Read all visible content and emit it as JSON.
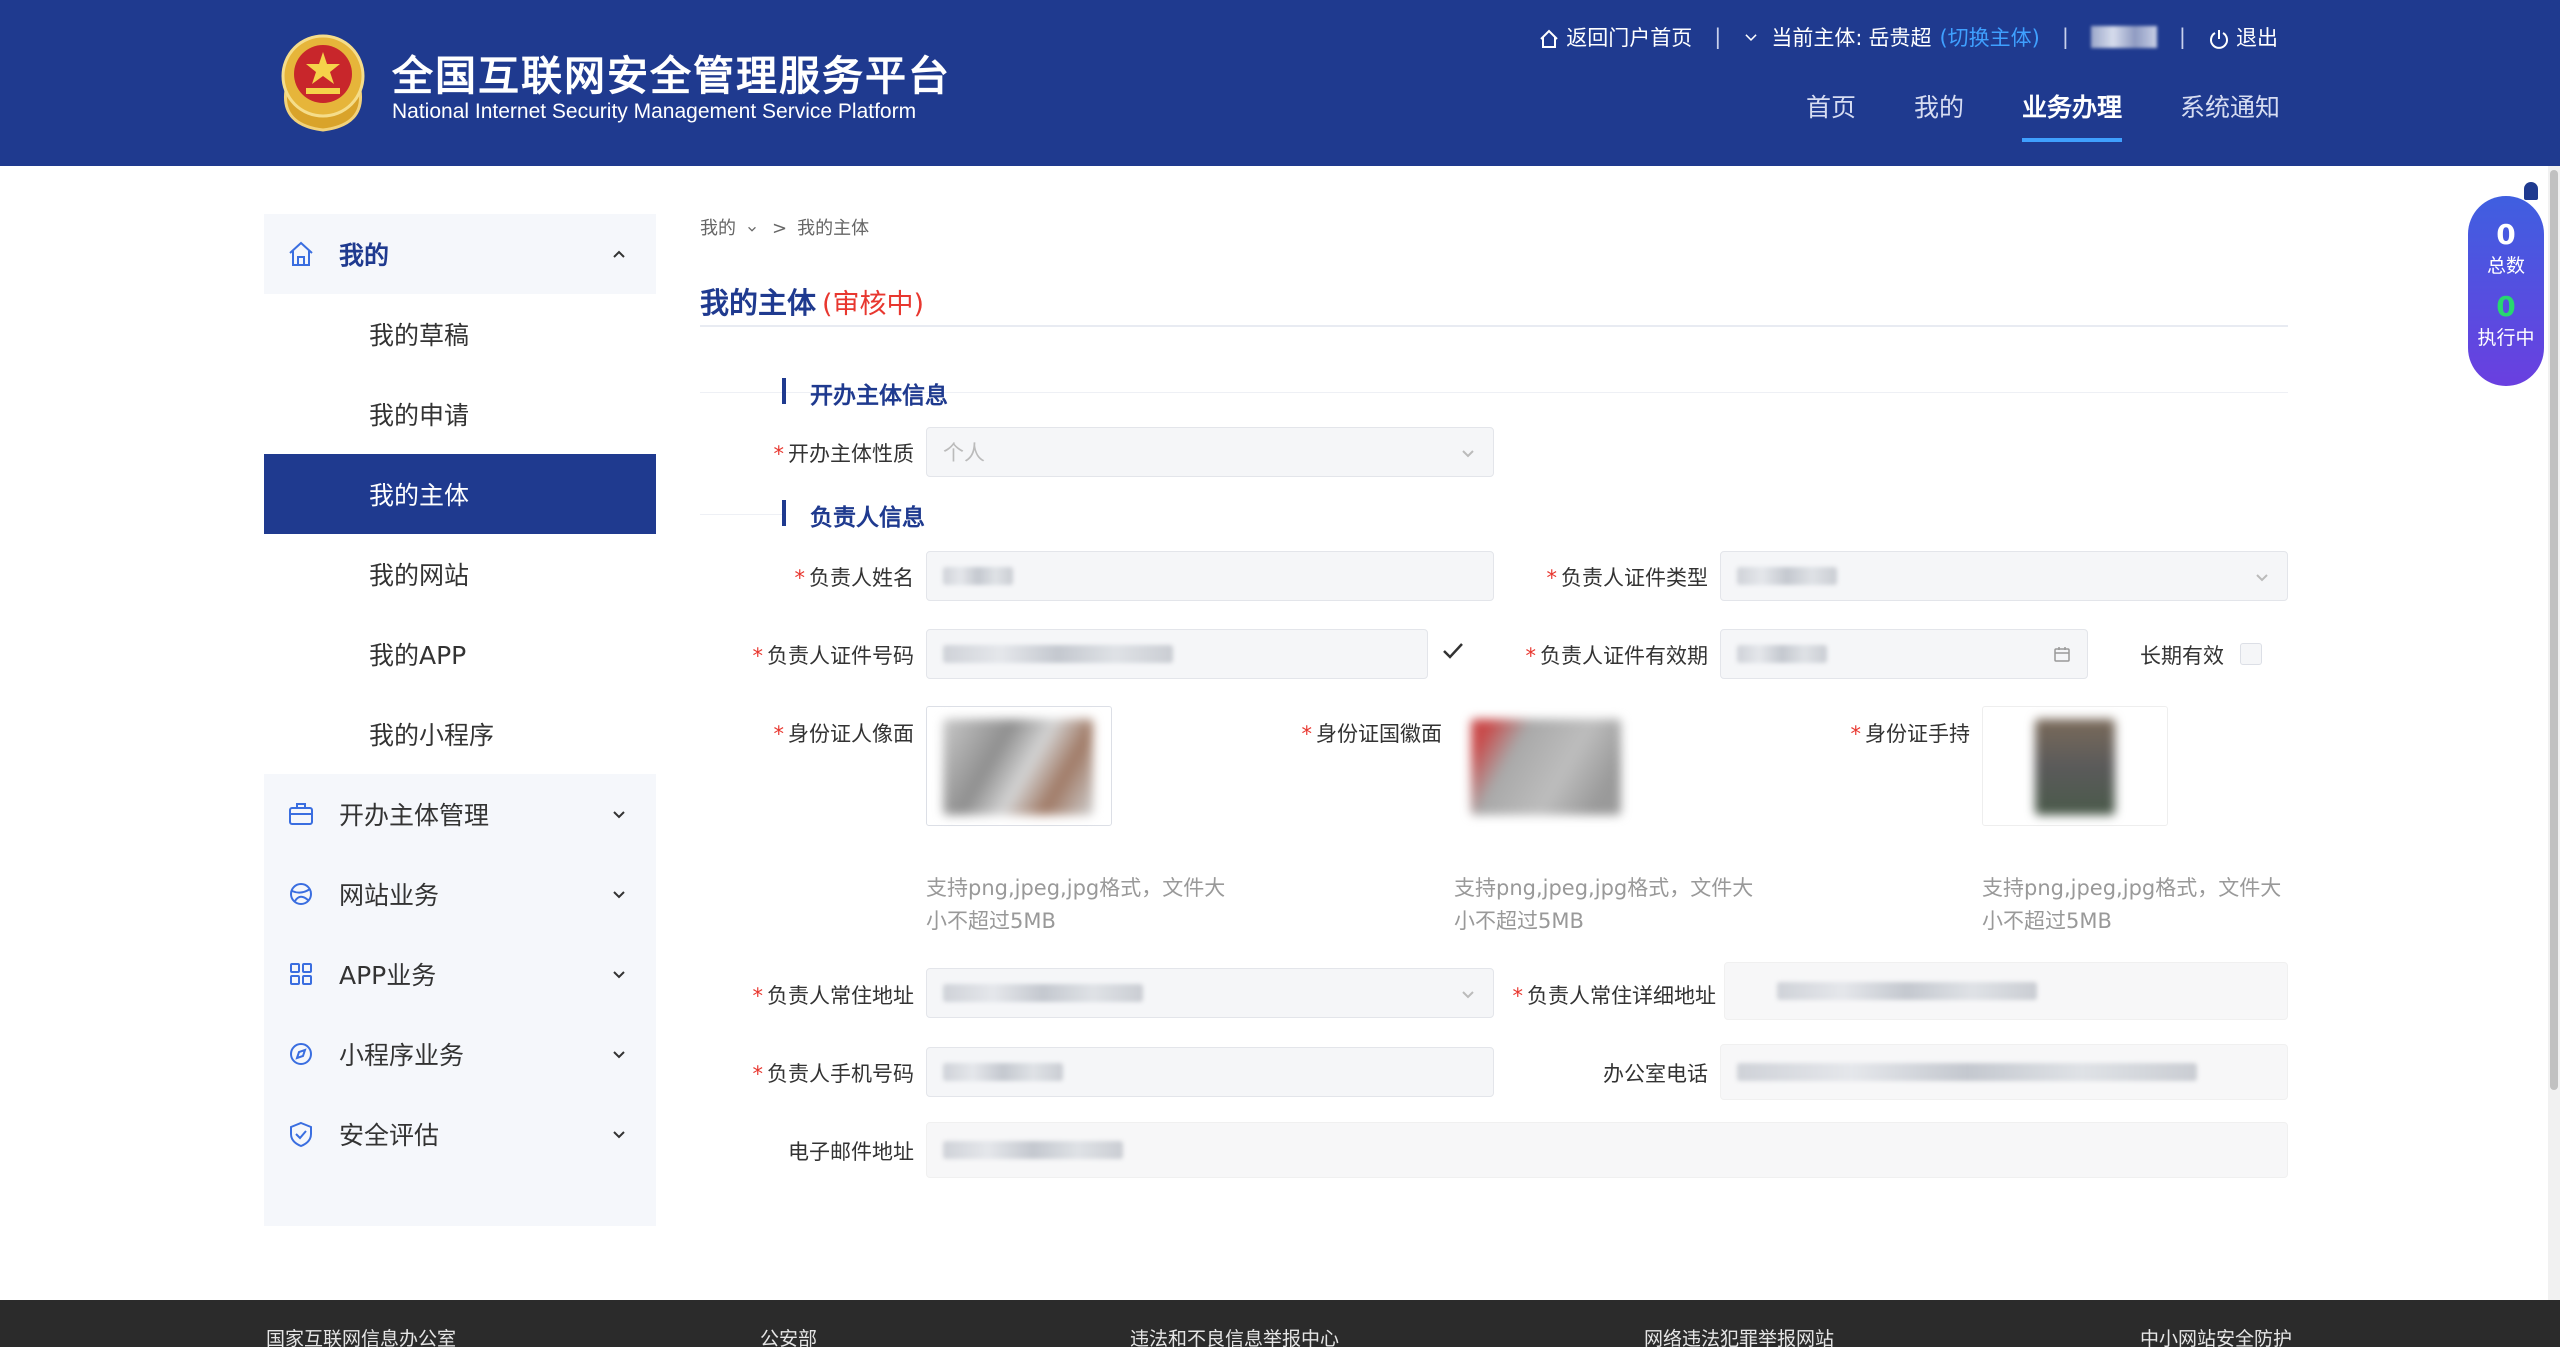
{
  "header": {
    "title": "全国互联网安全管理服务平台",
    "subtitle": "National Internet Security Management Service Platform",
    "back_home": "返回门户首页",
    "current_entity_label": "当前主体:",
    "current_entity_name": "岳贵超",
    "switch_entity": "(切换主体)",
    "logout": "退出",
    "nav": [
      "首页",
      "我的",
      "业务办理",
      "系统通知"
    ],
    "active_nav": "业务办理"
  },
  "sidebar": {
    "my_label": "我的",
    "my_items": [
      "我的草稿",
      "我的申请",
      "我的主体",
      "我的网站",
      "我的APP",
      "我的小程序"
    ],
    "active_item": "我的主体",
    "groups": [
      "开办主体管理",
      "网站业务",
      "APP业务",
      "小程序业务",
      "安全评估"
    ]
  },
  "breadcrumb": {
    "root": "我的",
    "sep": ">",
    "current": "我的主体"
  },
  "page": {
    "title": "我的主体",
    "status": "(审核中)"
  },
  "sections": {
    "entity_info": "开办主体信息",
    "person_info": "负责人信息"
  },
  "form": {
    "entity_nature_label": "开办主体性质",
    "entity_nature_value": "个人",
    "person_name_label": "负责人姓名",
    "id_type_label": "负责人证件类型",
    "id_number_label": "负责人证件号码",
    "id_validity_label": "负责人证件有效期",
    "long_term_label": "长期有效",
    "id_front_label": "身份证人像面",
    "id_back_label": "身份证国徽面",
    "id_hold_label": "身份证手持",
    "upload_hint": "支持png,jpeg,jpg格式，文件大小不超过5MB",
    "address_label": "负责人常住地址",
    "address_detail_label": "负责人常住详细地址",
    "phone_label": "负责人手机号码",
    "office_phone_label": "办公室电话",
    "email_label": "电子邮件地址"
  },
  "float_widget": {
    "total_count": "0",
    "total_label": "总数",
    "running_count": "0",
    "running_label": "执行中"
  },
  "footer": {
    "links": [
      "国家互联网信息办公室",
      "公安部",
      "违法和不良信息举报中心",
      "网络违法犯罪举报网站",
      "中小网站安全防护"
    ]
  },
  "colors": {
    "primary": "#1f3a8f",
    "accent": "#3fa0ff",
    "required": "#e8372f",
    "success": "#27d86f"
  }
}
